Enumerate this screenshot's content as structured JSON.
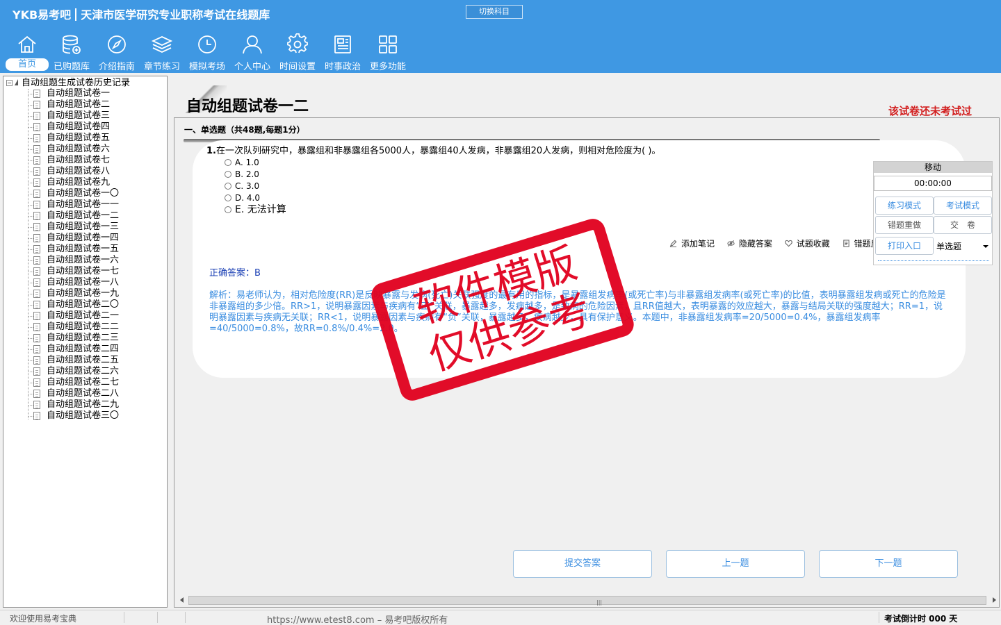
{
  "header": {
    "brand": "YKB易考吧",
    "app_title": "天津市医学研究专业职称考试在线题库",
    "switch_label": "切换科目"
  },
  "nav": [
    {
      "label": "首页",
      "icon": "home-icon",
      "active": true
    },
    {
      "label": "已购题库",
      "icon": "database-icon"
    },
    {
      "label": "介绍指南",
      "icon": "compass-icon"
    },
    {
      "label": "章节练习",
      "icon": "layers-icon"
    },
    {
      "label": "模拟考场",
      "icon": "clock-icon"
    },
    {
      "label": "个人中心",
      "icon": "user-icon"
    },
    {
      "label": "时间设置",
      "icon": "gear-icon"
    },
    {
      "label": "时事政治",
      "icon": "newspaper-icon"
    },
    {
      "label": "更多功能",
      "icon": "grid-icon"
    }
  ],
  "tree": {
    "root": "自动组题生成试卷历史记录",
    "items": [
      "自动组题试卷一",
      "自动组题试卷二",
      "自动组题试卷三",
      "自动组题试卷四",
      "自动组题试卷五",
      "自动组题试卷六",
      "自动组题试卷七",
      "自动组题试卷八",
      "自动组题试卷九",
      "自动组题试卷一〇",
      "自动组题试卷一一",
      "自动组题试卷一二",
      "自动组题试卷一三",
      "自动组题试卷一四",
      "自动组题试卷一五",
      "自动组题试卷一六",
      "自动组题试卷一七",
      "自动组题试卷一八",
      "自动组题试卷一九",
      "自动组题试卷二〇",
      "自动组题试卷二一",
      "自动组题试卷二二",
      "自动组题试卷二三",
      "自动组题试卷二四",
      "自动组题试卷二五",
      "自动组题试卷二六",
      "自动组题试卷二七",
      "自动组题试卷二八",
      "自动组题试卷二九",
      "自动组题试卷三〇"
    ]
  },
  "page": {
    "title": "自动组题试卷一二",
    "status": "该试卷还未考试过",
    "section": "一、单选题（共48题,每题1分）"
  },
  "question": {
    "number": "1.",
    "text": "在一次队列研究中，暴露组和非暴露组各5000人，暴露组40人发病，非暴露组20人发病，则相对危险度为( )。",
    "options": [
      "A. 1.0",
      "B. 2.0",
      "C. 3.0",
      "D. 4.0",
      "E. 无法计算"
    ]
  },
  "tools": {
    "note": "添加笔记",
    "hide_answer": "隐藏答案",
    "favorite": "试题收藏",
    "feedback": "错题反馈"
  },
  "answer": {
    "label": "正确答案：B",
    "analysis": "解析：易老师认为，相对危险度(RR)是反映暴露与发病(死亡)关联强度的最有用的指标，是暴露组发病率(或死亡率)与非暴露组发病率(或死亡率)的比值，表明暴露组发病或死亡的危险是非暴露组的多少倍。RR>1，说明暴露因素与疾病有“正”关联，暴露越多，发病越多，是致病的危险因素，且RR值越大，表明暴露的效应越大，暴露与结局关联的强度越大；RR=1，说明暴露因素与疾病无关联；RR<1，说明暴露因素与疾病有“负”关联，暴露越多，疾病越少，具有保护意义。本题中，非暴露组发病率=20/5000=0.4%，暴露组发病率=40/5000=0.8%，故RR=0.8%/0.4%=2.0。"
  },
  "side_panel": {
    "move": "移动",
    "timer": "00:00:00",
    "practice_mode": "练习模式",
    "exam_mode": "考试模式",
    "redo_wrong": "错题重做",
    "submit_paper": "交　卷",
    "print_entry": "打印入口",
    "question_type": "单选题"
  },
  "buttons": {
    "submit": "提交答案",
    "prev": "上一题",
    "next": "下一题"
  },
  "statusbar": {
    "welcome": "欢迎使用易考宝典",
    "url": "https://www.etest8.com – 易考吧版权所有",
    "countdown": "考试倒计时 000 天"
  },
  "stamp": {
    "line1": "软件模版",
    "line2": "仅供参考"
  },
  "colors": {
    "header_bg": "#3f98e3",
    "accent_blue": "#3a8de0",
    "status_red": "#d21e1e",
    "stamp_red": "#e1001e"
  }
}
